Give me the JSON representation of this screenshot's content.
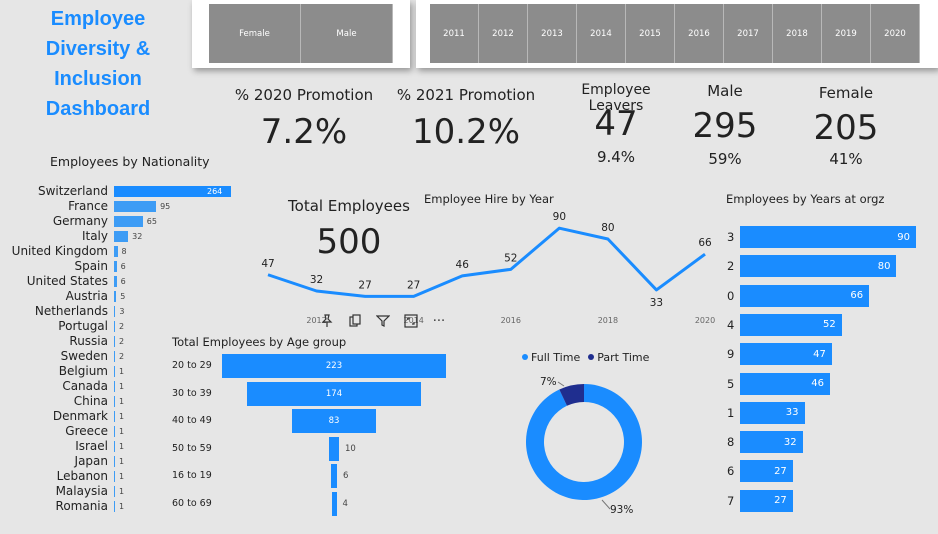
{
  "dashboard": {
    "title_lines": [
      "Employee",
      "Diversity &",
      "Inclusion",
      "Dashboard"
    ]
  },
  "gender_slicer": {
    "options": [
      "Female",
      "Male"
    ]
  },
  "year_slicer": {
    "options": [
      "2011",
      "2012",
      "2013",
      "2014",
      "2015",
      "2016",
      "2017",
      "2018",
      "2019",
      "2020"
    ]
  },
  "kpis": {
    "promo2020": {
      "label": "% 2020 Promotion",
      "value": "7.2%"
    },
    "promo2021": {
      "label": "% 2021 Promotion",
      "value": "10.2%"
    },
    "leavers": {
      "label": "Employee Leavers",
      "value": "47",
      "sub": "9.4%"
    },
    "male": {
      "label": "Male",
      "value": "295",
      "sub": "59%"
    },
    "female": {
      "label": "Female",
      "value": "205",
      "sub": "41%"
    },
    "total": {
      "label": "Total Employees",
      "value": "500"
    }
  },
  "colors": {
    "accent": "#1a8cff",
    "bar_light": "#3d9cf5",
    "dark_blue": "#1f2e8f",
    "slicer_gray": "#8c8c8c",
    "background": "#e6e6e6"
  },
  "visual_toolbar": {
    "icons": [
      "pin-icon",
      "copy-icon",
      "filter-icon",
      "focus-icon",
      "more-icon"
    ],
    "more_label": "···"
  },
  "chart_data": [
    {
      "id": "nationality",
      "type": "bar",
      "orientation": "horizontal",
      "title": "Employees by Nationality",
      "categories": [
        "Switzerland",
        "France",
        "Germany",
        "Italy",
        "United Kingdom",
        "Spain",
        "United States",
        "Austria",
        "Netherlands",
        "Portugal",
        "Russia",
        "Sweden",
        "Belgium",
        "Canada",
        "China",
        "Denmark",
        "Greece",
        "Israel",
        "Japan",
        "Lebanon",
        "Malaysia",
        "Romania"
      ],
      "values": [
        264,
        95,
        65,
        32,
        8,
        6,
        6,
        5,
        3,
        2,
        2,
        2,
        1,
        1,
        1,
        1,
        1,
        1,
        1,
        1,
        1,
        1
      ],
      "value_labels": [
        "264",
        "95",
        "65",
        "32",
        "8",
        "6",
        "6",
        "5",
        "3",
        "2",
        "2",
        "2",
        "1",
        "1",
        "1",
        "1",
        "1",
        "1",
        "1",
        "1",
        "1",
        "1"
      ]
    },
    {
      "id": "hire_by_year",
      "type": "line",
      "title": "Employee Hire by Year",
      "x": [
        2011,
        2012,
        2013,
        2014,
        2015,
        2016,
        2017,
        2018,
        2019,
        2020
      ],
      "values": [
        47,
        32,
        27,
        27,
        46,
        52,
        90,
        80,
        33,
        66
      ],
      "value_labels": [
        "47",
        "32",
        "27",
        "27",
        "46",
        "52",
        "90",
        "80",
        "33",
        "66"
      ],
      "x_ticks": [
        "2012",
        "2014",
        "2016",
        "2018",
        "2020"
      ]
    },
    {
      "id": "age_group",
      "type": "bar",
      "subtype": "funnel",
      "title": "Total Employees by Age group",
      "categories": [
        "20 to 29",
        "30 to 39",
        "40 to 49",
        "50 to 59",
        "16 to 19",
        "60 to 69"
      ],
      "values": [
        223,
        174,
        83,
        10,
        6,
        4
      ],
      "value_labels": [
        "223",
        "174",
        "83",
        "10",
        "6",
        "4"
      ]
    },
    {
      "id": "employment_type",
      "type": "pie",
      "subtype": "donut",
      "legend": [
        "Full Time",
        "Part Time"
      ],
      "values": [
        93,
        7
      ],
      "value_labels": [
        "93%",
        "7%"
      ],
      "colors": [
        "#1a8cff",
        "#1f2e8f"
      ]
    },
    {
      "id": "years_at_org",
      "type": "bar",
      "orientation": "horizontal",
      "title": "Employees by Years at orgz",
      "categories": [
        "3",
        "2",
        "0",
        "4",
        "9",
        "5",
        "1",
        "8",
        "6",
        "7"
      ],
      "values": [
        90,
        80,
        66,
        52,
        47,
        46,
        33,
        32,
        27,
        27
      ],
      "value_labels": [
        "90",
        "80",
        "66",
        "52",
        "47",
        "46",
        "33",
        "32",
        "27",
        "27"
      ]
    }
  ]
}
